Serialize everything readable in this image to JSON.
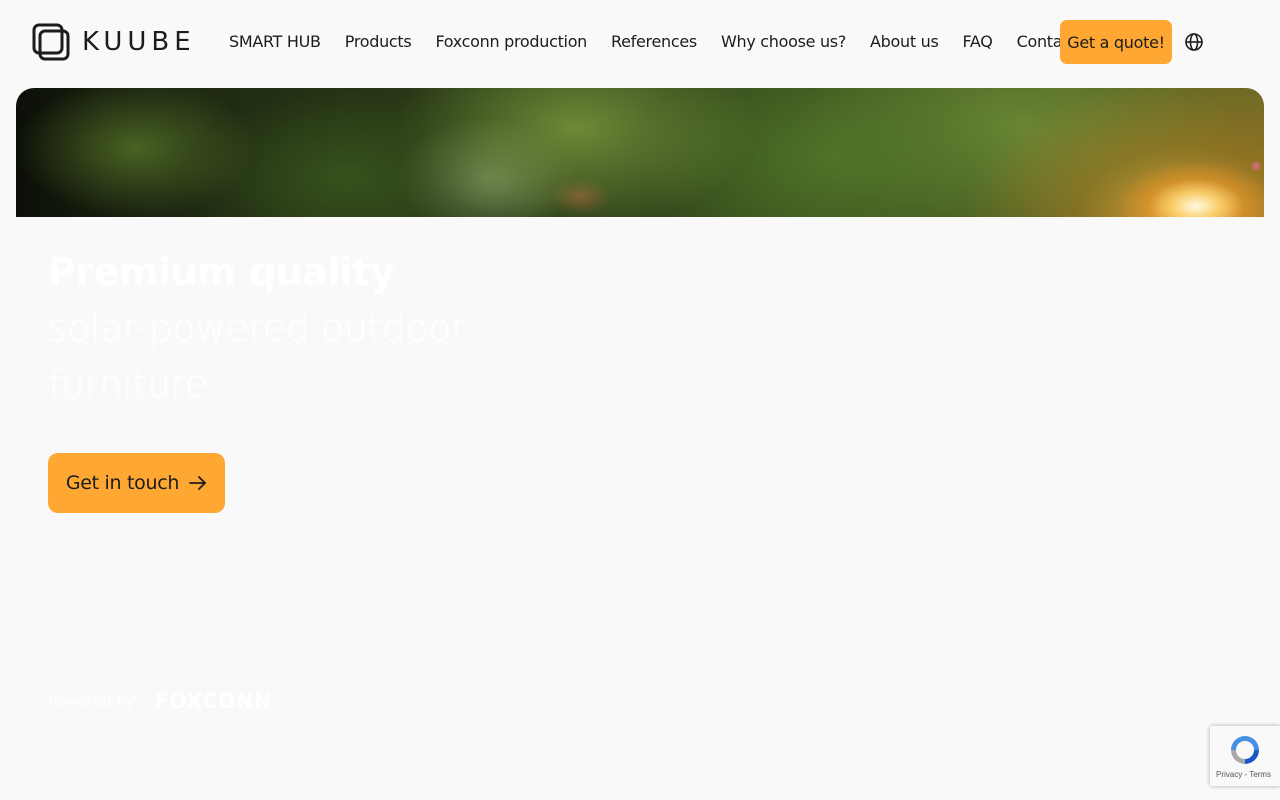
{
  "header": {
    "logo_text": "KUUBE",
    "logo_icon": "kuube-cube-logo-icon",
    "nav": [
      {
        "label": "SMART HUB"
      },
      {
        "label": "Products"
      },
      {
        "label": "Foxconn production"
      },
      {
        "label": "References"
      },
      {
        "label": "Why choose us?"
      },
      {
        "label": "About us"
      },
      {
        "label": "FAQ"
      },
      {
        "label": "Contact"
      }
    ],
    "quote_button": "Get a quote!",
    "language_icon": "globe-icon"
  },
  "hero": {
    "title_strong": "Premium quality",
    "title_light": "solar-powered outdoor furniture",
    "cta_label": "Get in touch",
    "cta_icon": "arrow-right-icon",
    "powered_label": "Powered by:",
    "powered_logo": "FOXCONN"
  },
  "recaptcha": {
    "links": "Privacy - Terms",
    "icon": "recaptcha-icon"
  },
  "colors": {
    "accent": "#ffa733",
    "background": "#f9f9f9",
    "text": "#1c1c1c",
    "hero_text": "#ffffff"
  }
}
